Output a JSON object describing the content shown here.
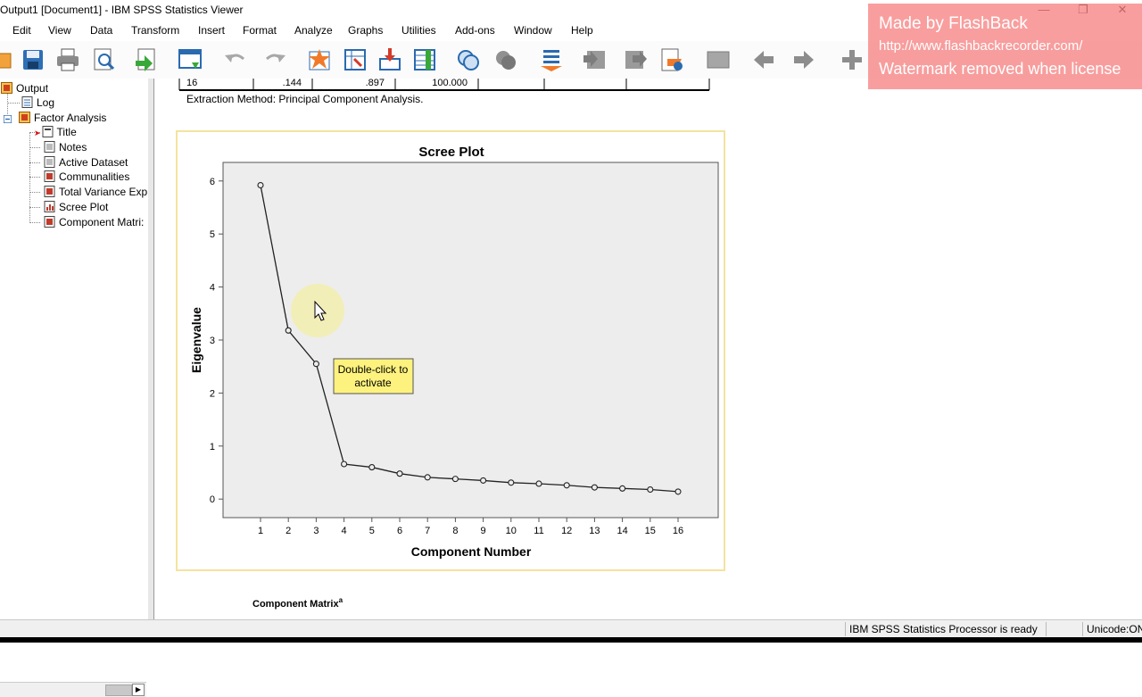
{
  "window": {
    "title": "Output1 [Document1] - IBM SPSS Statistics Viewer"
  },
  "menu": [
    "Edit",
    "View",
    "Data",
    "Transform",
    "Insert",
    "Format",
    "Analyze",
    "Graphs",
    "Utilities",
    "Add-ons",
    "Window",
    "Help"
  ],
  "nav": {
    "root": "Output",
    "log": "Log",
    "factor": "Factor Analysis",
    "children": [
      "Title",
      "Notes",
      "Active Dataset",
      "Communalities",
      "Total Variance Exp",
      "Scree Plot",
      "Component Matri:"
    ]
  },
  "table_row": [
    "16",
    ".144",
    ".897",
    "100.000"
  ],
  "extraction_note": "Extraction Method: Principal Component Analysis.",
  "tooltip": {
    "line1": "Double-click to",
    "line2": "activate"
  },
  "component_matrix_title": "Component Matrix",
  "component_matrix_sup": "a",
  "status": {
    "processor": "IBM SPSS Statistics Processor is ready",
    "encoding": "Unicode:ON"
  },
  "watermark": {
    "line1": "Made by FlashBack",
    "line2": "http://www.flashbackrecorder.com/",
    "line3": "Watermark removed when license"
  },
  "colors": {
    "chart_bg": "#ededed",
    "chart_border": "#f4e3a0",
    "tooltip_bg": "#fdf27e",
    "watermark_bg": "#f67878"
  },
  "chart_data": {
    "type": "line",
    "title": "Scree Plot",
    "xlabel": "Component Number",
    "ylabel": "Eigenvalue",
    "categories": [
      "1",
      "2",
      "3",
      "4",
      "5",
      "6",
      "7",
      "8",
      "9",
      "10",
      "11",
      "12",
      "13",
      "14",
      "15",
      "16"
    ],
    "values": [
      5.92,
      3.18,
      2.55,
      0.66,
      0.6,
      0.48,
      0.41,
      0.38,
      0.35,
      0.31,
      0.29,
      0.26,
      0.22,
      0.2,
      0.18,
      0.14
    ],
    "yticks": [
      "0",
      "1",
      "2",
      "3",
      "4",
      "5",
      "6"
    ],
    "ylim": [
      -0.35,
      6.35
    ],
    "grid": false,
    "markers": "open-circle"
  }
}
